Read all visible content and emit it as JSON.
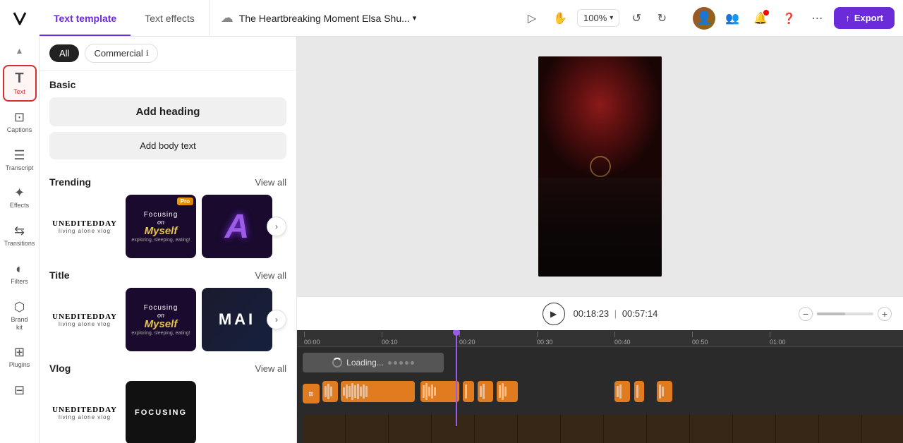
{
  "topbar": {
    "logo_alt": "Kapwing logo",
    "tabs": [
      {
        "id": "text-template",
        "label": "Text template",
        "active": true
      },
      {
        "id": "text-effects",
        "label": "Text effects",
        "active": false
      }
    ],
    "project_name": "The Heartbreaking Moment Elsa Shu...",
    "zoom_level": "100%",
    "undo_label": "Undo",
    "redo_label": "Redo",
    "export_label": "Export"
  },
  "sidebar": {
    "collapse_icon": "chevron-up",
    "items": [
      {
        "id": "text",
        "label": "Text",
        "icon": "T",
        "active": true
      },
      {
        "id": "captions",
        "label": "Captions",
        "active": false
      },
      {
        "id": "transcript",
        "label": "Transcript",
        "active": false
      },
      {
        "id": "effects",
        "label": "Effects",
        "active": false
      },
      {
        "id": "transitions",
        "label": "Transitions",
        "active": false
      },
      {
        "id": "filters",
        "label": "Filters",
        "active": false
      },
      {
        "id": "brand",
        "label": "Brand\nkit",
        "active": false
      },
      {
        "id": "plugins",
        "label": "Plugins",
        "active": false
      },
      {
        "id": "subtitles",
        "label": "Subtitles",
        "active": false
      }
    ]
  },
  "panel": {
    "filter_all": "All",
    "filter_commercial": "Commercial",
    "sections": {
      "basic": {
        "title": "Basic",
        "add_heading": "Add heading",
        "add_body": "Add body text"
      },
      "trending": {
        "title": "Trending",
        "view_all": "View all",
        "templates": [
          {
            "id": "unedited-day",
            "style": "unedited",
            "name": "UNEDITEDDAY",
            "sub": "living alone vlog"
          },
          {
            "id": "focusing-myself-pro",
            "style": "focusing",
            "name": "Focusing",
            "on": "on",
            "myself": "Myself",
            "sub": "exploring, sleeping, eating!",
            "pro": true
          },
          {
            "id": "letter-a",
            "style": "letter-a",
            "letter": "A"
          }
        ]
      },
      "title": {
        "title": "Title",
        "view_all": "View all",
        "templates": [
          {
            "id": "unedited-day-2",
            "style": "unedited",
            "name": "UNEDITEDDAY",
            "sub": "living alone vlog"
          },
          {
            "id": "focusing-myself-2",
            "style": "focusing",
            "name": "Focusing",
            "on": "on",
            "myself": "Myself",
            "sub": "exploring, sleeping, eating!"
          },
          {
            "id": "mai",
            "style": "mai",
            "text": "MAI"
          }
        ]
      },
      "vlog": {
        "title": "Vlog",
        "view_all": "View all",
        "templates": [
          {
            "id": "vlog-unedited",
            "style": "unedited",
            "name": "UNEDITEDDAY",
            "sub": "living alone vlog"
          },
          {
            "id": "vlog-focusing",
            "style": "vlog-focusing",
            "name": "Focusing"
          }
        ]
      }
    }
  },
  "timeline": {
    "current_time": "00:18:23",
    "total_time": "00:57:14",
    "playhead_position_percent": 29,
    "ruler_marks": [
      "00:00",
      "00:10",
      "00:20",
      "00:30",
      "00:40",
      "00:50",
      "01:00"
    ],
    "loading_text": "Loading...",
    "zoom_minus": "−",
    "zoom_plus": "+"
  }
}
